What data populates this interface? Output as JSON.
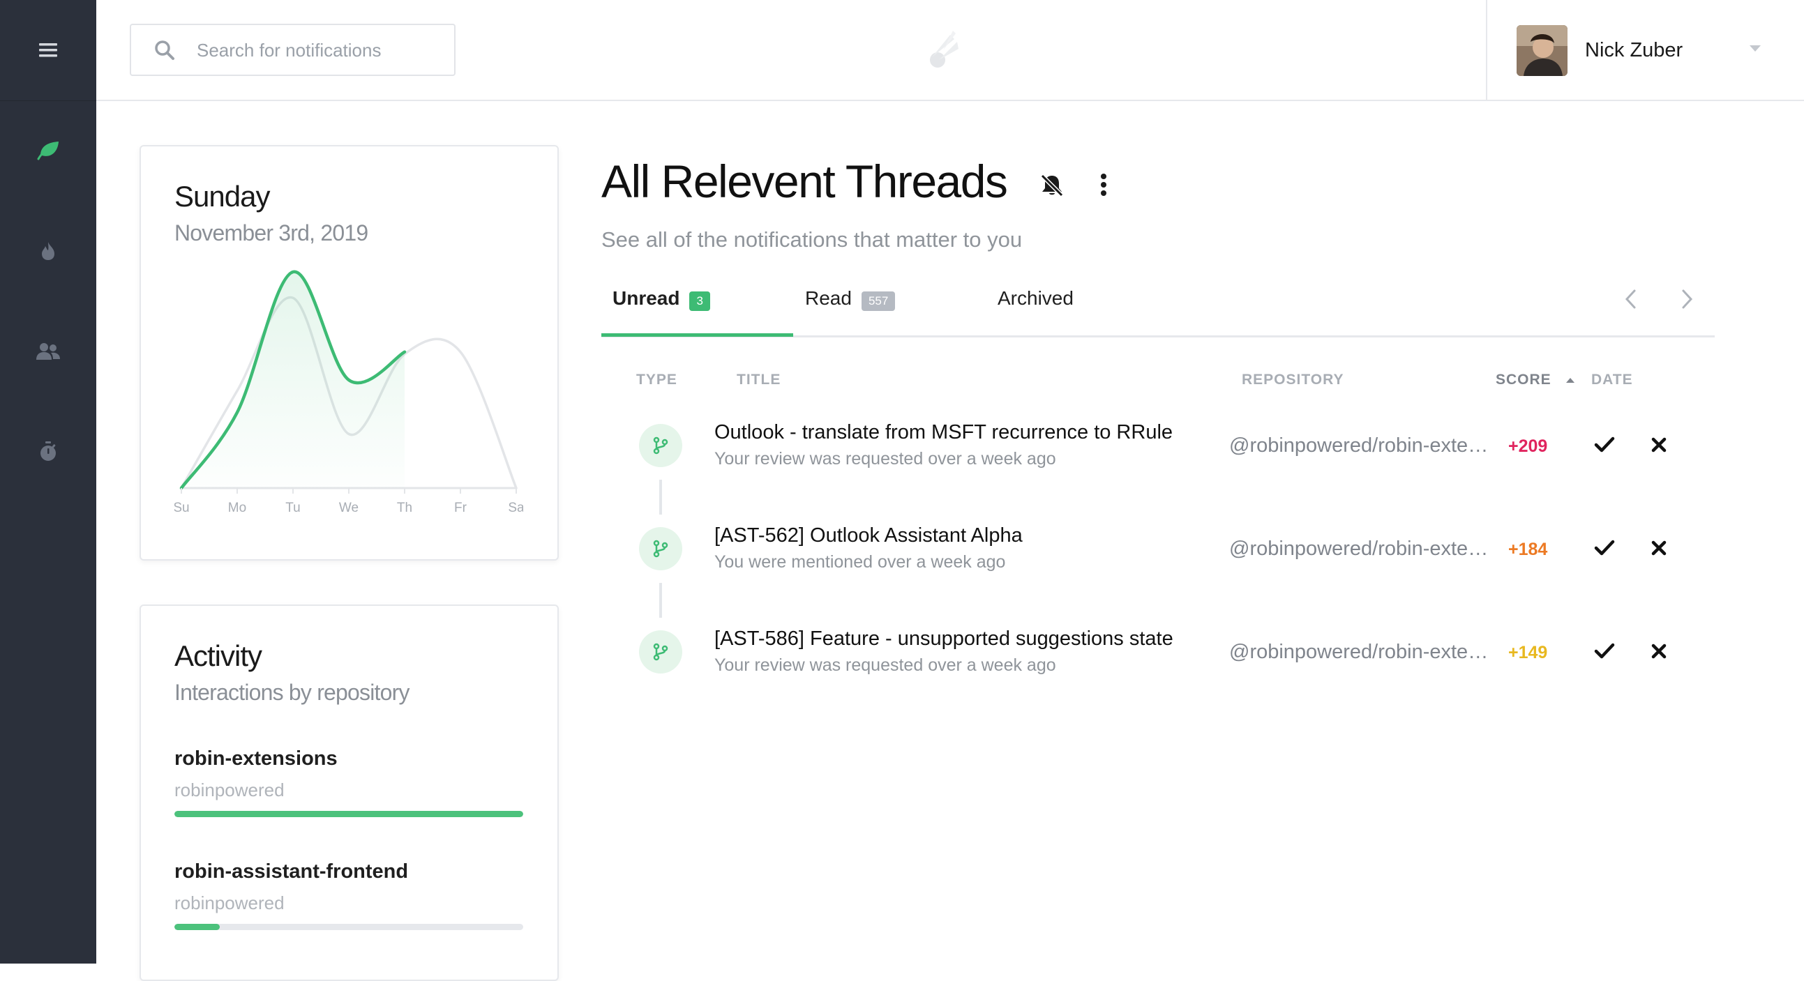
{
  "search": {
    "placeholder": "Search for notifications"
  },
  "user": {
    "name": "Nick Zuber"
  },
  "sidebar": {
    "items": [
      {
        "icon": "leaf-icon",
        "active": true
      },
      {
        "icon": "flame-icon",
        "active": false
      },
      {
        "icon": "users-icon",
        "active": false
      },
      {
        "icon": "stopwatch-icon",
        "active": false
      }
    ]
  },
  "day_card": {
    "title": "Sunday",
    "date": "November 3rd, 2019"
  },
  "chart_data": {
    "type": "line",
    "categories": [
      "Su",
      "Mo",
      "Tu",
      "We",
      "Th",
      "Fr",
      "Sa"
    ],
    "series": [
      {
        "values": [
          0,
          35,
          100,
          50,
          63
        ],
        "color": "#3dbb74"
      },
      {
        "values": [
          0,
          45,
          88,
          25,
          62,
          63,
          0
        ],
        "color": "#e3e5e8"
      }
    ],
    "title": "",
    "xlabel": "",
    "ylabel": "",
    "grid": false
  },
  "activity": {
    "title": "Activity",
    "subtitle": "Interactions by repository",
    "repos": [
      {
        "name": "robin-extensions",
        "owner": "robinpowered",
        "fraction": 1.0
      },
      {
        "name": "robin-assistant-frontend",
        "owner": "robinpowered",
        "fraction": 0.13
      }
    ]
  },
  "main": {
    "title": "All Relevent Threads",
    "subtitle": "See all of the notifications that matter to you",
    "tabs": [
      {
        "label": "Unread",
        "badge": "3"
      },
      {
        "label": "Read",
        "badge": "557"
      },
      {
        "label": "Archived"
      }
    ],
    "columns": {
      "type": "TYPE",
      "title": "TITLE",
      "repository": "REPOSITORY",
      "score": "SCORE",
      "date": "DATE"
    },
    "rows": [
      {
        "title": "Outlook - translate from MSFT recurrence to RRule",
        "subtitle": "Your review was requested over a week ago",
        "repository": "@robinpowered/robin-extensions",
        "score": "+209",
        "score_color": "#e0245e"
      },
      {
        "title": "[AST-562] Outlook Assistant Alpha",
        "subtitle": "You were mentioned over a week ago",
        "repository": "@robinpowered/robin-extensions",
        "score": "+184",
        "score_color": "#ec7a24"
      },
      {
        "title": "[AST-586] Feature - unsupported suggestions state",
        "subtitle": "Your review was requested over a week ago",
        "repository": "@robinpowered/robin-extensions",
        "score": "+149",
        "score_color": "#e8b820"
      }
    ]
  }
}
